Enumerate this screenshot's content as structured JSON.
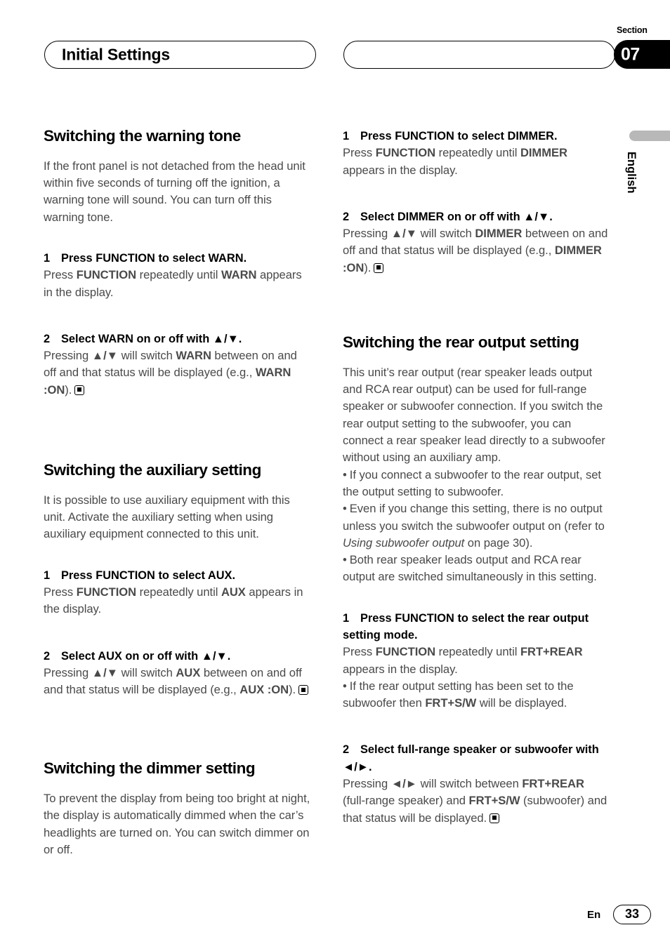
{
  "header": {
    "title": "Initial Settings",
    "section_label": "Section",
    "section_number": "07"
  },
  "edge": {
    "language": "English"
  },
  "footer": {
    "locale": "En",
    "page_number": "33"
  },
  "left_column": {
    "section1": {
      "heading": "Switching the warning tone",
      "intro": "If the front panel is not detached from the head unit within five seconds of turning off the ignition, a warning tone will sound. You can turn off this warning tone.",
      "step1_title_num": "1",
      "step1_title": "Press FUNCTION to select WARN.",
      "step1_body_a": "Press ",
      "step1_body_b": "FUNCTION",
      "step1_body_c": " repeatedly until ",
      "step1_body_d": "WARN",
      "step1_body_e": " appears in the display.",
      "step2_title_num": "2",
      "step2_title": "Select WARN on or off with ▲/▼.",
      "step2_body_a": "Pressing ",
      "step2_body_b": "▲/▼",
      "step2_body_c": " will switch ",
      "step2_body_d": "WARN",
      "step2_body_e": " between on and off and that status will be displayed (e.g., ",
      "step2_body_f": "WARN :ON",
      "step2_body_g": ")."
    },
    "section2": {
      "heading": "Switching the auxiliary setting",
      "intro": "It is possible to use auxiliary equipment with this unit. Activate the auxiliary setting when using auxiliary equipment connected to this unit.",
      "step1_title_num": "1",
      "step1_title": "Press FUNCTION to select AUX.",
      "step1_body_a": "Press ",
      "step1_body_b": "FUNCTION",
      "step1_body_c": " repeatedly until ",
      "step1_body_d": "AUX",
      "step1_body_e": " appears in the display.",
      "step2_title_num": "2",
      "step2_title": "Select AUX on or off with ▲/▼.",
      "step2_body_a": "Pressing ",
      "step2_body_b": "▲/▼",
      "step2_body_c": " will switch ",
      "step2_body_d": "AUX",
      "step2_body_e": " between on and off and that status will be displayed (e.g., ",
      "step2_body_f": "AUX :ON",
      "step2_body_g": ")."
    },
    "section3": {
      "heading": "Switching the dimmer setting",
      "intro": "To prevent the display from being too bright at night, the display is automatically dimmed when the car’s headlights are turned on. You can switch dimmer on or off."
    }
  },
  "right_column": {
    "dimmer_steps": {
      "step1_title_num": "1",
      "step1_title": "Press FUNCTION to select DIMMER.",
      "step1_body_a": "Press ",
      "step1_body_b": "FUNCTION",
      "step1_body_c": " repeatedly until ",
      "step1_body_d": "DIMMER",
      "step1_body_e": " appears in the display.",
      "step2_title_num": "2",
      "step2_title": "Select DIMMER on or off with ▲/▼.",
      "step2_body_a": "Pressing ",
      "step2_body_b": "▲/▼",
      "step2_body_c": " will switch ",
      "step2_body_d": "DIMMER",
      "step2_body_e": " between on and off and that status will be displayed (e.g., ",
      "step2_body_f": "DIMMER :ON",
      "step2_body_g": ")."
    },
    "section4": {
      "heading": "Switching the rear output setting",
      "intro": "This unit’s rear output (rear speaker leads output and RCA rear output) can be used for full-range speaker or subwoofer connection. If you switch the rear output setting to the subwoofer, you can connect a rear speaker lead directly to a subwoofer without using an auxiliary amp.",
      "bullet1": "If you connect a subwoofer to the rear output, set the output setting to subwoofer.",
      "bullet2_a": "Even if you change this setting, there is no output unless you switch the subwoofer output on (refer to ",
      "bullet2_em": "Using subwoofer output",
      "bullet2_b": " on page 30).",
      "bullet3": "Both rear speaker leads output and RCA rear output are switched simultaneously in this setting.",
      "step1_title_num": "1",
      "step1_title": "Press FUNCTION to select the rear output setting mode.",
      "step1_body_a": "Press ",
      "step1_body_b": "FUNCTION",
      "step1_body_c": " repeatedly until ",
      "step1_body_d": "FRT+REAR",
      "step1_body_e": " appears in the display.",
      "step1_bullet_a": "If the rear output setting has been set to the subwoofer then ",
      "step1_bullet_b": "FRT+S/W",
      "step1_bullet_c": " will be displayed.",
      "step2_title_num": "2",
      "step2_title": "Select full-range speaker or subwoofer with ◄/►.",
      "step2_body_a": "Pressing ",
      "step2_body_b": "◄/►",
      "step2_body_c": " will switch between ",
      "step2_body_d": "FRT+REAR",
      "step2_body_e": " (full-range speaker) and ",
      "step2_body_f": "FRT+S/W",
      "step2_body_g": " (subwoofer) and that status will be displayed."
    }
  },
  "bullet_glyph": "•"
}
